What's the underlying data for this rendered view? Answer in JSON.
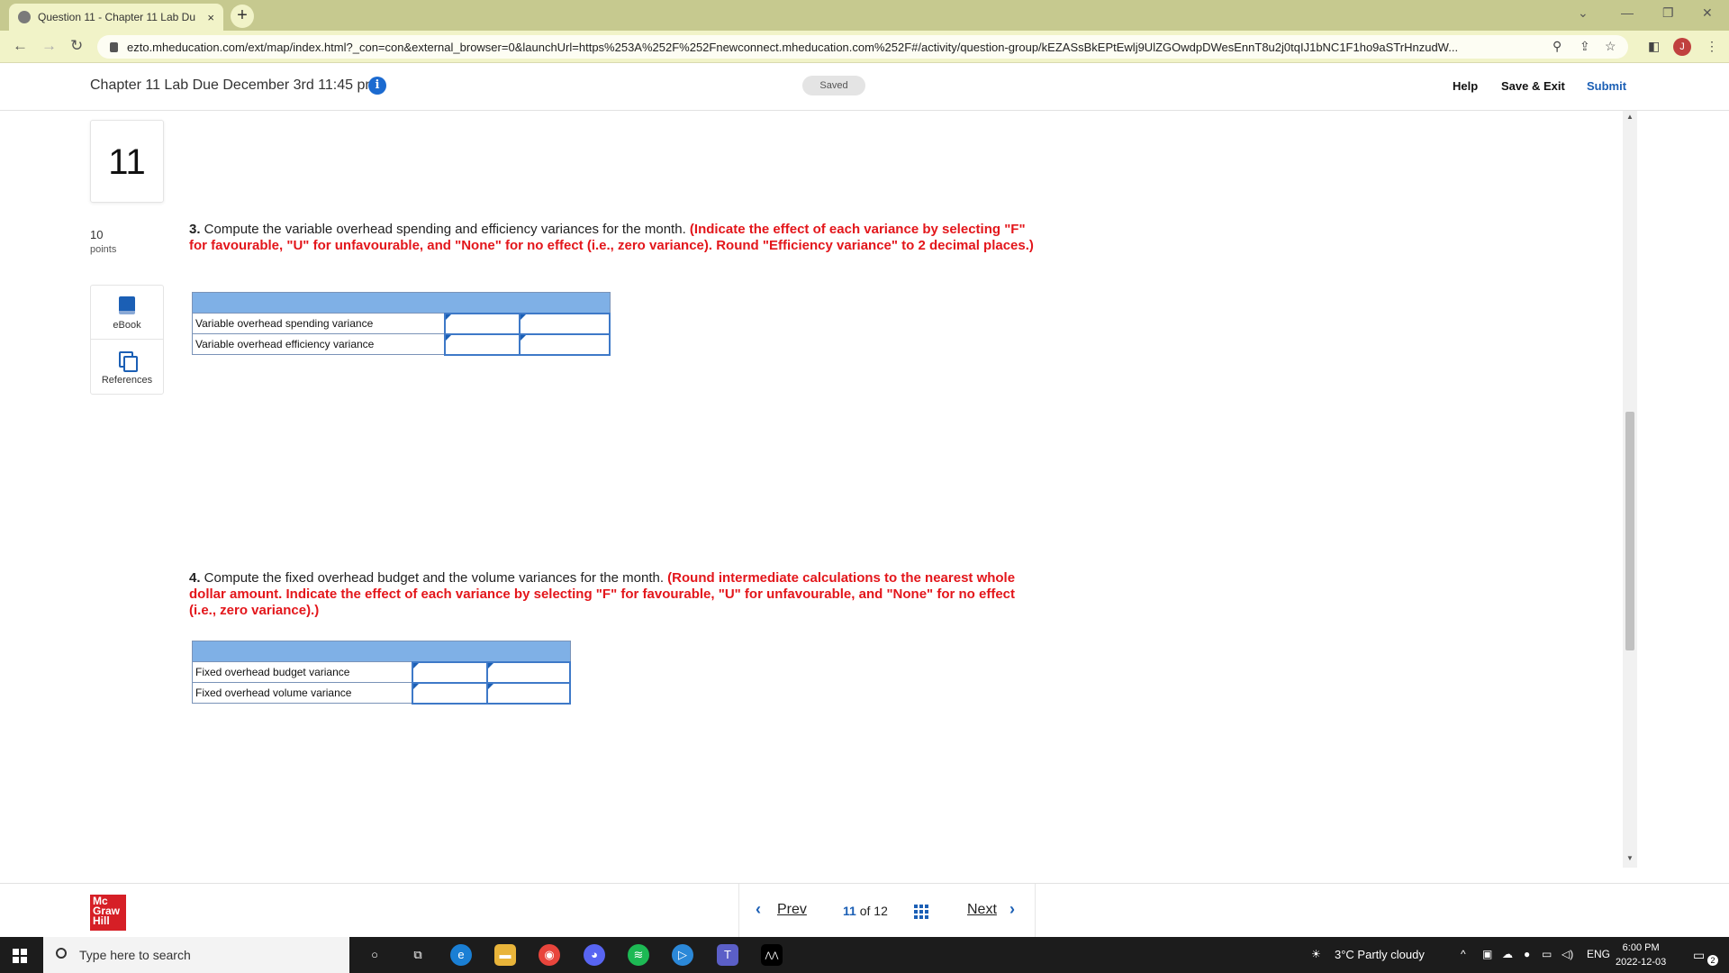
{
  "browser": {
    "tab_title": "Question 11 - Chapter 11 Lab Du",
    "tab_close": "×",
    "new_tab": "+",
    "url": "ezto.mheducation.com/ext/map/index.html?_con=con&external_browser=0&launchUrl=https%253A%252F%252Fnewconnect.mheducation.com%252F#/activity/question-group/kEZASsBkEPtEwlj9UlZGOwdpDWesEnnT8u2j0tqIJ1bNC1F1ho9aSTrHnzudW...",
    "profile_initial": "J"
  },
  "header": {
    "assignment_title": "Chapter 11 Lab Due December 3rd 11:45 pm",
    "info": "i",
    "saved": "Saved",
    "help": "Help",
    "save_exit": "Save & Exit",
    "submit": "Submit"
  },
  "sidebar": {
    "question_number": "11",
    "points_value": "10",
    "points_label": "points",
    "ebook": "eBook",
    "references": "References"
  },
  "q3": {
    "number": "3.",
    "text": " Compute the variable overhead spending and efficiency variances for the month. ",
    "instruction": "(Indicate the effect of each variance by selecting \"F\" for favourable, \"U\" for unfavourable, and \"None\" for no effect (i.e., zero variance). Round \"Efficiency variance\" to 2 decimal places.)",
    "rows": [
      "Variable overhead spending variance",
      "Variable overhead efficiency variance"
    ]
  },
  "q4": {
    "number": "4.",
    "text": " Compute the fixed overhead budget and the volume variances for the month. ",
    "instruction": "(Round intermediate calculations to the nearest whole dollar amount. Indicate the effect of each variance by selecting \"F\" for favourable, \"U\" for unfavourable, and \"None\" for no effect (i.e., zero variance).)",
    "rows": [
      "Fixed overhead budget variance",
      "Fixed overhead volume variance"
    ]
  },
  "footer": {
    "logo": "Mc Graw Hill",
    "prev": "Prev",
    "current": "11",
    "of": "of",
    "total": "12",
    "next": "Next"
  },
  "taskbar": {
    "search_placeholder": "Type here to search",
    "weather": "3°C  Partly cloudy",
    "lang": "ENG",
    "time": "6:00 PM",
    "date": "2022-12-03",
    "notifications": "2"
  },
  "colors": {
    "accent": "#1b5fb5",
    "instruction_red": "#e3161b",
    "table_header": "#7fb0e6",
    "brand_red": "#d61f26"
  }
}
